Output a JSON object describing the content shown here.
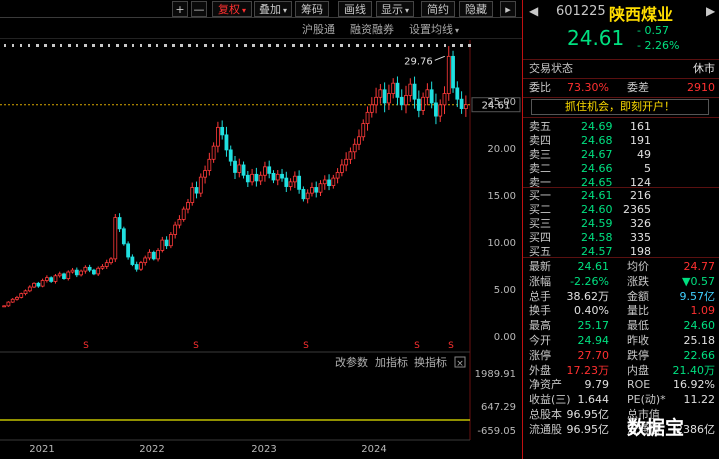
{
  "toolbar": {
    "plus": "+",
    "minus": "—",
    "fuquan": "复权",
    "diejia": "叠加",
    "chouma": "筹码",
    "huaxian": "画线",
    "xianshi": "显示",
    "jianyue": "简约",
    "yincang": "隐藏",
    "more": "▸",
    "colors": {
      "accent": "#ff3030"
    }
  },
  "indicators": {
    "hugutong": "沪股通",
    "rongzi": "融资融券",
    "junxian": "设置均线"
  },
  "chart_data": {
    "type": "candlestick",
    "title": "",
    "y_ticks": [
      {
        "v": 25.0,
        "label": "25.00"
      },
      {
        "v": 20.0,
        "label": "20.00"
      },
      {
        "v": 15.0,
        "label": "15.00"
      },
      {
        "v": 10.0,
        "label": "10.00"
      },
      {
        "v": 5.0,
        "label": "5.00"
      },
      {
        "v": 0.0,
        "label": "0.00"
      }
    ],
    "ylim": [
      -1.5,
      31.5
    ],
    "current_price": "24.61",
    "max_label": "29.76",
    "x_labels": [
      "2021",
      "2022",
      "2023",
      "2024"
    ],
    "series": [
      {
        "values": [
          3.2,
          3.6,
          3.9,
          4.1,
          4.5,
          4.8,
          5.2,
          5.6,
          5.3,
          5.9,
          6.2,
          5.8,
          6.4,
          6.6,
          6.1,
          6.8,
          7.0,
          6.5,
          6.9,
          7.3,
          7.0,
          6.6,
          7.2,
          7.4,
          7.8,
          8.2,
          12.6,
          11.4,
          9.8,
          8.4,
          7.6,
          7.1,
          7.8,
          8.3,
          8.9,
          8.2,
          9.1,
          10.2,
          9.6,
          10.8,
          11.8,
          12.4,
          13.5,
          14.2,
          15.8,
          15.2,
          16.9,
          17.6,
          18.8,
          20.2,
          22.2,
          21.4,
          19.8,
          18.6,
          17.4,
          18.2,
          17.1,
          16.4,
          17.2,
          16.5,
          17.1,
          18.0,
          17.3,
          16.6,
          17.2,
          16.8,
          15.9,
          16.4,
          17.0,
          15.6,
          14.6,
          15.2,
          15.8,
          15.3,
          16.2,
          16.6,
          16.0,
          16.8,
          17.4,
          18.2,
          18.8,
          19.6,
          20.4,
          21.2,
          22.6,
          23.8,
          24.6,
          25.4,
          26.2,
          24.8,
          25.8,
          26.9,
          25.4,
          24.6,
          25.6,
          26.8,
          25.2,
          24.0,
          25.4,
          26.2,
          24.8,
          23.4,
          24.6,
          25.8,
          29.76,
          26.4,
          25.2,
          24.2,
          24.61
        ]
      }
    ],
    "volume_ticks": [
      {
        "v": 1989.91,
        "label": "1989.91"
      },
      {
        "v": 647.29,
        "label": "647.29"
      },
      {
        "v": -659.05,
        "label": "-659.05"
      }
    ],
    "sub_buttons": {
      "gai": "改参数",
      "jia": "加指标",
      "huan": "换指标"
    }
  },
  "quote": {
    "code": "601225",
    "name": "陕西煤业",
    "price": "24.61",
    "change": "- 0.57",
    "change_pct": "- 2.26%",
    "status_label": "交易状态",
    "status_value": "休市",
    "weibi_label": "委比",
    "weibi_value": "73.30%",
    "weicha_label": "委差",
    "weicha_value": "2910",
    "promo": "抓住机会，即刻开户！",
    "sell": [
      {
        "label": "卖五",
        "price": "24.69",
        "vol": "161"
      },
      {
        "label": "卖四",
        "price": "24.68",
        "vol": "191"
      },
      {
        "label": "卖三",
        "price": "24.67",
        "vol": "49"
      },
      {
        "label": "卖二",
        "price": "24.66",
        "vol": "5"
      },
      {
        "label": "卖一",
        "price": "24.65",
        "vol": "124"
      }
    ],
    "buy": [
      {
        "label": "买一",
        "price": "24.61",
        "vol": "216"
      },
      {
        "label": "买二",
        "price": "24.60",
        "vol": "2365"
      },
      {
        "label": "买三",
        "price": "24.59",
        "vol": "326"
      },
      {
        "label": "买四",
        "price": "24.58",
        "vol": "335"
      },
      {
        "label": "买五",
        "price": "24.57",
        "vol": "198"
      }
    ],
    "stats": [
      {
        "l1": "最新",
        "v1": "24.61",
        "c1": "g",
        "l2": "均价",
        "v2": "24.77",
        "c2": "r"
      },
      {
        "l1": "涨幅",
        "v1": "-2.26%",
        "c1": "g",
        "l2": "涨跌",
        "v2": "▼0.57",
        "c2": "g"
      },
      {
        "l1": "总手",
        "v1": "38.62万",
        "c1": "w",
        "l2": "金额",
        "v2": "9.57亿",
        "c2": "c"
      },
      {
        "l1": "换手",
        "v1": "0.40%",
        "c1": "w",
        "l2": "量比",
        "v2": "1.09",
        "c2": "r"
      },
      {
        "l1": "最高",
        "v1": "25.17",
        "c1": "g",
        "l2": "最低",
        "v2": "24.60",
        "c2": "g"
      },
      {
        "l1": "今开",
        "v1": "24.94",
        "c1": "g",
        "l2": "昨收",
        "v2": "25.18",
        "c2": "w"
      },
      {
        "l1": "涨停",
        "v1": "27.70",
        "c1": "r",
        "l2": "跌停",
        "v2": "22.66",
        "c2": "g"
      },
      {
        "l1": "外盘",
        "v1": "17.23万",
        "c1": "r",
        "l2": "内盘",
        "v2": "21.40万",
        "c2": "g"
      },
      {
        "l1": "净资产",
        "v1": "9.79",
        "c1": "w",
        "l2": "ROE",
        "v2": "16.92%",
        "c2": "w"
      },
      {
        "l1": "收益(三)",
        "v1": "1.644",
        "c1": "w",
        "l2": "PE(动)*",
        "v2": "11.22",
        "c2": "w"
      },
      {
        "l1": "总股本",
        "v1": "96.95亿",
        "c1": "w",
        "l2": "总市值",
        "v2": "",
        "c2": "w"
      },
      {
        "l1": "流通股",
        "v1": "96.95亿",
        "c1": "w",
        "l2": "流通值",
        "v2": "2386亿",
        "c2": "w"
      }
    ],
    "watermark": "数据宝"
  }
}
